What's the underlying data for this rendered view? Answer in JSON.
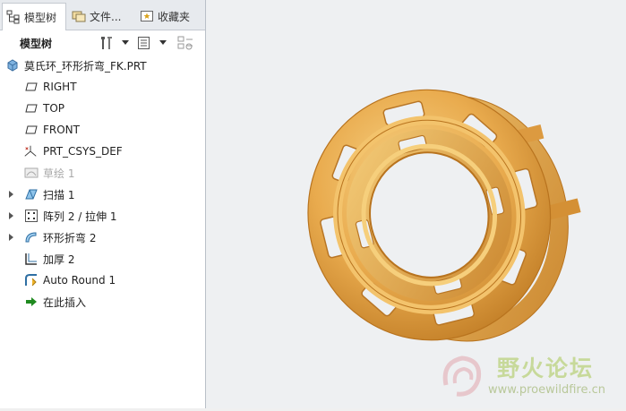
{
  "tabs": [
    {
      "label": "模型树",
      "icon": "model-tree-icon",
      "active": true
    },
    {
      "label": "文件...",
      "icon": "folder-icon",
      "active": false
    },
    {
      "label": "收藏夹",
      "icon": "favorites-icon",
      "active": false
    }
  ],
  "toolbar": {
    "title": "模型树",
    "icons": [
      "settings-tools-icon",
      "show-columns-icon",
      "filter-icon"
    ]
  },
  "tree": {
    "root": "莫氏环_环形折弯_FK.PRT",
    "items": [
      {
        "label": "RIGHT",
        "icon": "datum-plane-icon",
        "expandable": false,
        "dim": false
      },
      {
        "label": "TOP",
        "icon": "datum-plane-icon",
        "expandable": false,
        "dim": false
      },
      {
        "label": "FRONT",
        "icon": "datum-plane-icon",
        "expandable": false,
        "dim": false
      },
      {
        "label": "PRT_CSYS_DEF",
        "icon": "csys-icon",
        "expandable": false,
        "dim": false
      },
      {
        "label": "草绘 1",
        "icon": "sketch-icon",
        "expandable": false,
        "dim": true
      },
      {
        "label": "扫描 1",
        "icon": "sweep-icon",
        "expandable": true,
        "dim": false
      },
      {
        "label": "阵列 2 / 拉伸 1",
        "icon": "pattern-icon",
        "expandable": true,
        "dim": false
      },
      {
        "label": "环形折弯 2",
        "icon": "toroidal-bend-icon",
        "expandable": true,
        "dim": false
      },
      {
        "label": "加厚 2",
        "icon": "thicken-icon",
        "expandable": false,
        "dim": false
      },
      {
        "label": "Auto Round 1",
        "icon": "auto-round-icon",
        "expandable": false,
        "dim": false
      },
      {
        "label": "在此插入",
        "icon": "insert-here-arrow-icon",
        "expandable": false,
        "dim": false
      }
    ]
  },
  "watermark": {
    "title": "野火论坛",
    "url": "www.proewildfire.cn"
  },
  "colors": {
    "part": "#e8a94a",
    "part_light": "#f6cf7c",
    "part_dark": "#b8731e",
    "viewport_bg": "#eef0f2"
  }
}
